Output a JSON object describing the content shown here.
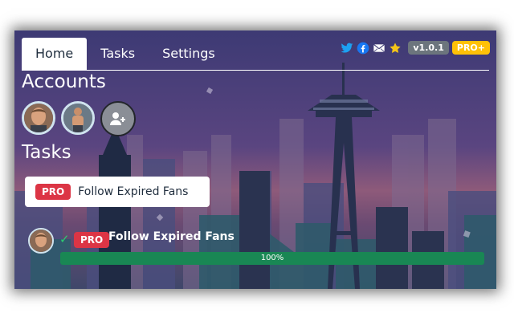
{
  "tabs": [
    {
      "label": "Home",
      "active": true
    },
    {
      "label": "Tasks",
      "active": false
    },
    {
      "label": "Settings",
      "active": false
    }
  ],
  "header_icons": [
    "twitter-icon",
    "facebook-icon",
    "mail-icon",
    "star-icon"
  ],
  "version_badge": "v1.0.1",
  "plan_badge": "PRO+",
  "accounts": {
    "heading": "Accounts",
    "avatars": [
      "account-avatar-1",
      "account-avatar-2"
    ],
    "add_icon": "add-account-icon"
  },
  "tasks": {
    "heading": "Tasks",
    "card": {
      "badge": "PRO",
      "label": "Follow Expired Fans"
    }
  },
  "task_run": {
    "status_icon": "check-icon",
    "check": "✓",
    "badge": "PRO",
    "title": "Follow Expired Fans",
    "progress": 100,
    "progress_label": "100%"
  },
  "colors": {
    "accent_green": "#198754",
    "pro_red": "#dc3545",
    "pro_plus_yellow": "#ffc107",
    "version_gray": "#6c757d"
  }
}
